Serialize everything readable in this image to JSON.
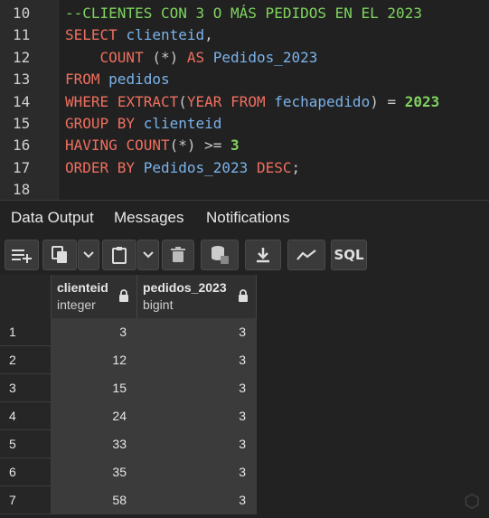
{
  "editor": {
    "lines": [
      {
        "n": "10",
        "tokens": [
          {
            "t": "--CLIENTES CON 3 O MÁS PEDIDOS EN EL 2023",
            "c": "cm"
          }
        ]
      },
      {
        "n": "11",
        "tokens": [
          {
            "t": "SELECT",
            "c": "kw"
          },
          {
            "t": " ",
            "c": "op"
          },
          {
            "t": "clienteid",
            "c": "id"
          },
          {
            "t": ",",
            "c": "op"
          }
        ]
      },
      {
        "n": "12",
        "tokens": [
          {
            "t": "    COUNT",
            "c": "kw"
          },
          {
            "t": " (*) ",
            "c": "op"
          },
          {
            "t": "AS",
            "c": "kw"
          },
          {
            "t": " ",
            "c": "op"
          },
          {
            "t": "Pedidos_2023",
            "c": "id"
          }
        ]
      },
      {
        "n": "13",
        "tokens": [
          {
            "t": "FROM",
            "c": "kw"
          },
          {
            "t": " ",
            "c": "op"
          },
          {
            "t": "pedidos",
            "c": "id"
          }
        ]
      },
      {
        "n": "14",
        "tokens": [
          {
            "t": "WHERE",
            "c": "kw"
          },
          {
            "t": " ",
            "c": "op"
          },
          {
            "t": "EXTRACT",
            "c": "kw"
          },
          {
            "t": "(",
            "c": "op"
          },
          {
            "t": "YEAR",
            "c": "kw"
          },
          {
            "t": " ",
            "c": "op"
          },
          {
            "t": "FROM",
            "c": "kw"
          },
          {
            "t": " ",
            "c": "op"
          },
          {
            "t": "fechapedido",
            "c": "id"
          },
          {
            "t": ") = ",
            "c": "op"
          },
          {
            "t": "2023",
            "c": "num"
          }
        ]
      },
      {
        "n": "15",
        "tokens": [
          {
            "t": "GROUP BY",
            "c": "kw"
          },
          {
            "t": " ",
            "c": "op"
          },
          {
            "t": "clienteid",
            "c": "id"
          }
        ]
      },
      {
        "n": "16",
        "tokens": [
          {
            "t": "HAVING",
            "c": "kw"
          },
          {
            "t": " ",
            "c": "op"
          },
          {
            "t": "COUNT",
            "c": "kw"
          },
          {
            "t": "(*) >= ",
            "c": "op"
          },
          {
            "t": "3",
            "c": "num"
          }
        ]
      },
      {
        "n": "17",
        "tokens": [
          {
            "t": "ORDER BY",
            "c": "kw"
          },
          {
            "t": " ",
            "c": "op"
          },
          {
            "t": "Pedidos_2023",
            "c": "id"
          },
          {
            "t": " ",
            "c": "op"
          },
          {
            "t": "DESC",
            "c": "kw"
          },
          {
            "t": ";",
            "c": "op"
          }
        ]
      },
      {
        "n": "18",
        "tokens": []
      }
    ]
  },
  "tabs": [
    {
      "label": "Data Output",
      "active": true
    },
    {
      "label": "Messages",
      "active": false
    },
    {
      "label": "Notifications",
      "active": false
    }
  ],
  "toolbar": {
    "buttons": [
      {
        "name": "add-row-icon"
      },
      {
        "name": "copy-icon"
      },
      {
        "name": "copy-dropdown-chevron-icon"
      },
      {
        "name": "paste-icon"
      },
      {
        "name": "paste-dropdown-chevron-icon"
      },
      {
        "name": "delete-icon"
      },
      {
        "name": "save-data-icon"
      },
      {
        "name": "download-icon"
      },
      {
        "name": "graph-icon"
      },
      {
        "name": "sql-icon",
        "label": "SQL"
      }
    ]
  },
  "grid": {
    "columns": [
      {
        "name": "clienteid",
        "type": "integer"
      },
      {
        "name": "pedidos_2023",
        "type": "bigint"
      }
    ],
    "rows": [
      {
        "n": "1",
        "clienteid": "3",
        "pedidos_2023": "3"
      },
      {
        "n": "2",
        "clienteid": "12",
        "pedidos_2023": "3"
      },
      {
        "n": "3",
        "clienteid": "15",
        "pedidos_2023": "3"
      },
      {
        "n": "4",
        "clienteid": "24",
        "pedidos_2023": "3"
      },
      {
        "n": "5",
        "clienteid": "33",
        "pedidos_2023": "3"
      },
      {
        "n": "6",
        "clienteid": "35",
        "pedidos_2023": "3"
      },
      {
        "n": "7",
        "clienteid": "58",
        "pedidos_2023": "3"
      }
    ]
  },
  "watermark": "Platzi",
  "colors": {
    "keyword": "#ef6f5f",
    "identifier": "#7bb3ea",
    "number": "#7fd45f",
    "comment": "#7fd45f",
    "background": "#222222"
  }
}
